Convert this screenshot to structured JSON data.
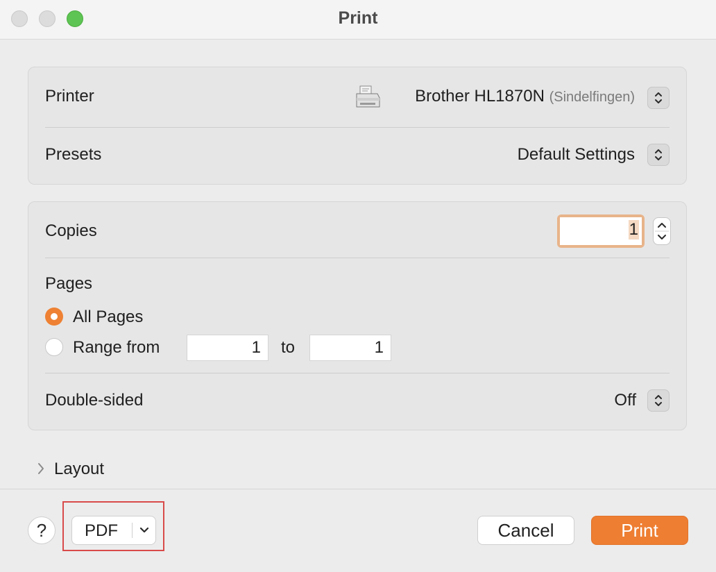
{
  "window": {
    "title": "Print"
  },
  "printer_panel": {
    "printer_label": "Printer",
    "printer_name": "Brother HL1870N",
    "printer_location": "(Sindelfingen)",
    "presets_label": "Presets",
    "presets_value": "Default Settings"
  },
  "options_panel": {
    "copies_label": "Copies",
    "copies_value": "1",
    "pages_label": "Pages",
    "all_pages_label": "All Pages",
    "all_pages_selected": true,
    "range_label": "Range from",
    "range_from": "1",
    "range_to_label": "to",
    "range_to": "1",
    "double_sided_label": "Double-sided",
    "double_sided_value": "Off"
  },
  "layout_section": {
    "label": "Layout",
    "expanded": false
  },
  "footer": {
    "help_label": "?",
    "pdf_label": "PDF",
    "cancel_label": "Cancel",
    "print_label": "Print"
  },
  "colors": {
    "accent": "#ee7e32",
    "highlight_box": "#d94a4a"
  },
  "icons": {
    "printer": "printer-icon",
    "stepper": "up-down-chevron-icon",
    "disclosure": "chevron-right-icon",
    "pdf_menu": "chevron-down-icon"
  }
}
